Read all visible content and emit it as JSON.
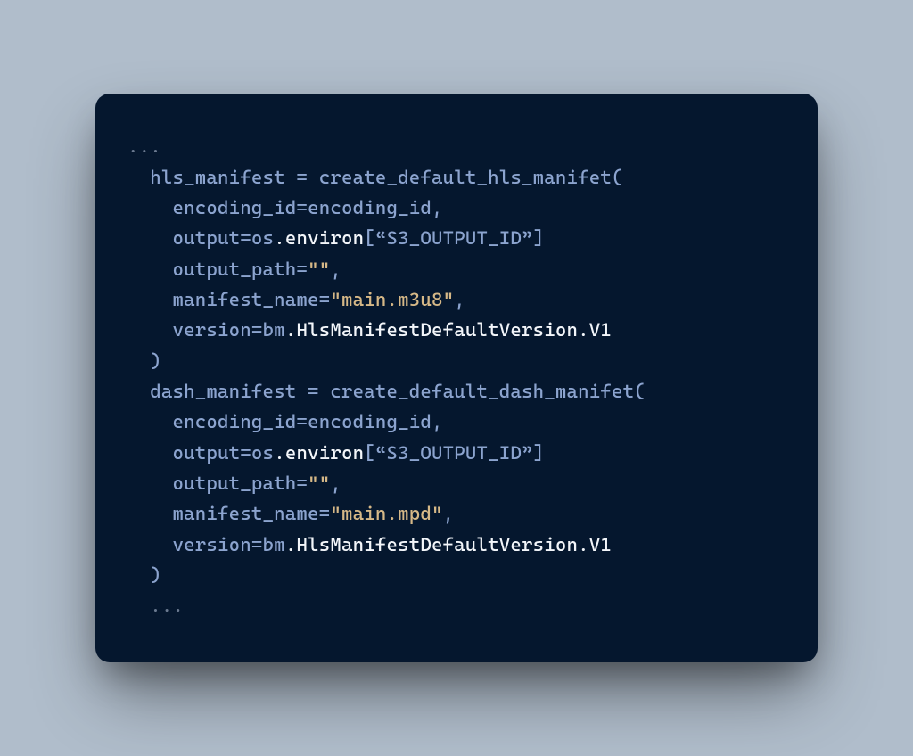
{
  "code": {
    "ellipsis_top": "...",
    "hls_assign_lhs": "hls_manifest ",
    "equals": "= ",
    "hls_fn": "create_default_hls_manifet",
    "open_paren": "(",
    "close_paren": ")",
    "encoding_id_param": "encoding_id",
    "encoding_id_rhs": "encoding_id",
    "comma": ",",
    "output_param": "output",
    "os_token": "os",
    "dot": ".",
    "environ_token": "environ",
    "bracket_open": "[",
    "s3_output_id": "“S3_OUTPUT_ID”",
    "bracket_close": "]",
    "output_path_param": "output_path",
    "empty_str": "\"\"",
    "manifest_name_param": "manifest_name",
    "hls_manifest_name_val": "\"main.m3u8\"",
    "version_param": "version",
    "bm_token": "bm",
    "hls_version_class": "HlsManifestDefaultVersion",
    "v1_token": "V1",
    "dash_assign_lhs": "dash_manifest ",
    "dash_fn": "create_default_dash_manifet",
    "dash_manifest_name_val": "\"main.mpd\"",
    "ellipsis_bottom": "..."
  }
}
